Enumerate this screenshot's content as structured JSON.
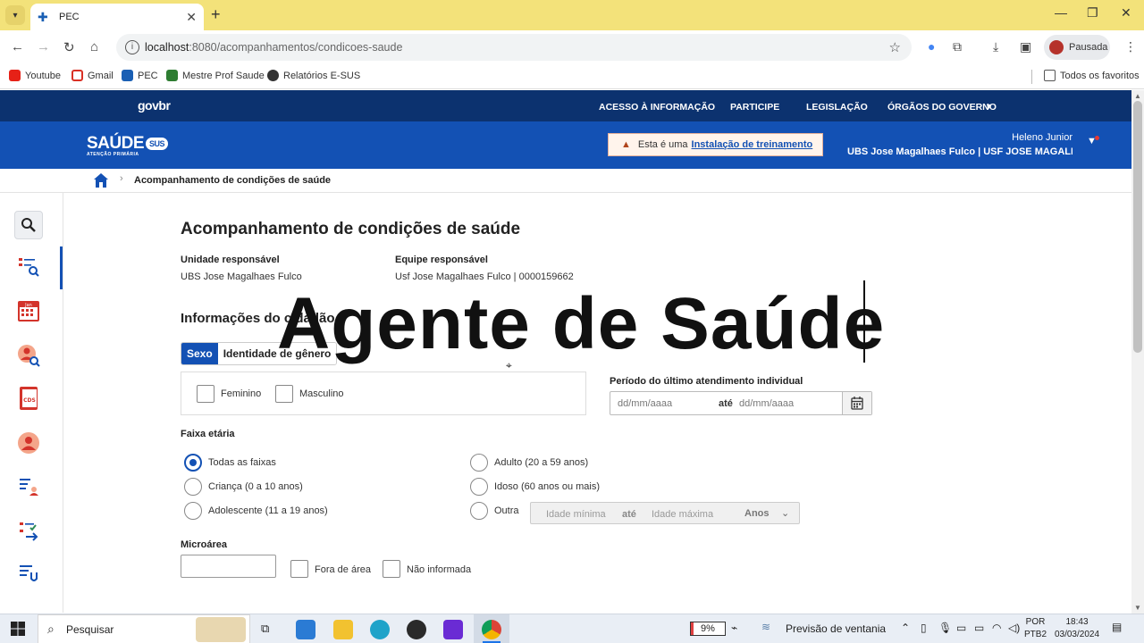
{
  "browser": {
    "tab_title": "PEC",
    "url_host": "localhost",
    "url_rest": ":8080/acompanhamentos/condicoes-saude",
    "profile_label": "Pausada",
    "bookmarks": [
      "Youtube",
      "Gmail",
      "PEC",
      "Mestre Prof Saude",
      "Relatórios E-SUS"
    ],
    "all_bookmarks": "Todos os favoritos"
  },
  "gov": {
    "logo": "govbr",
    "links": [
      "ACESSO À INFORMAÇÃO",
      "PARTICIPE",
      "LEGISLAÇÃO",
      "ÓRGÃOS DO GOVERNO"
    ]
  },
  "header": {
    "logo_main": "SAÚDE",
    "logo_badge": "SUS",
    "logo_sub": "ATENÇÃO PRIMÁRIA",
    "training_prefix": "Esta é uma",
    "training_link": "Instalação de treinamento",
    "user_name": "Heleno Junior",
    "user_unit": "UBS Jose Magalhaes Fulco | USF JOSE MAGALHAES"
  },
  "breadcrumb": {
    "current": "Acompanhamento de condições de saúde"
  },
  "page": {
    "title": "Acompanhamento de condições de saúde",
    "unidade_label": "Unidade responsável",
    "unidade_value": "UBS Jose Magalhaes Fulco",
    "equipe_label": "Equipe responsável",
    "equipe_value": "Usf Jose Magalhaes Fulco | 0000159662",
    "section_title": "Informações do cidadão",
    "segment": [
      "Sexo",
      "Identidade de gênero"
    ],
    "sexo_options": [
      "Feminino",
      "Masculino"
    ],
    "periodo_label": "Período do último atendimento individual",
    "date_placeholder_start": "dd/mm/aaaa",
    "date_ate": "até",
    "date_placeholder_end": "dd/mm/aaaa",
    "faixa_label": "Faixa etária",
    "faixa_options_left": [
      "Todas as faixas",
      "Criança (0 a 10 anos)",
      "Adolescente (11 a 19 anos)"
    ],
    "faixa_options_right": [
      "Adulto (20 a 59 anos)",
      "Idoso (60 anos ou mais)",
      "Outra"
    ],
    "faixa_selected": "Todas as faixas",
    "idade_min_placeholder": "Idade mínima",
    "idade_ate": "até",
    "idade_max_placeholder": "Idade máxima",
    "idade_unit": "Anos",
    "microarea_label": "Microárea",
    "microarea_value": "",
    "microarea_checks": [
      "Fora de área",
      "Não informada"
    ]
  },
  "overlay_text": "Agente de Saúde",
  "taskbar": {
    "search_placeholder": "Pesquisar",
    "battery": "9%",
    "battery_level": 0.09,
    "weather": "Previsão de ventania",
    "lang_top": "POR",
    "lang_bottom": "PTB2",
    "time": "18:43",
    "date": "03/03/2024"
  },
  "colors": {
    "gov_bar": "#0c326f",
    "header": "#1351b4",
    "tabstrip": "#f3e27a"
  }
}
